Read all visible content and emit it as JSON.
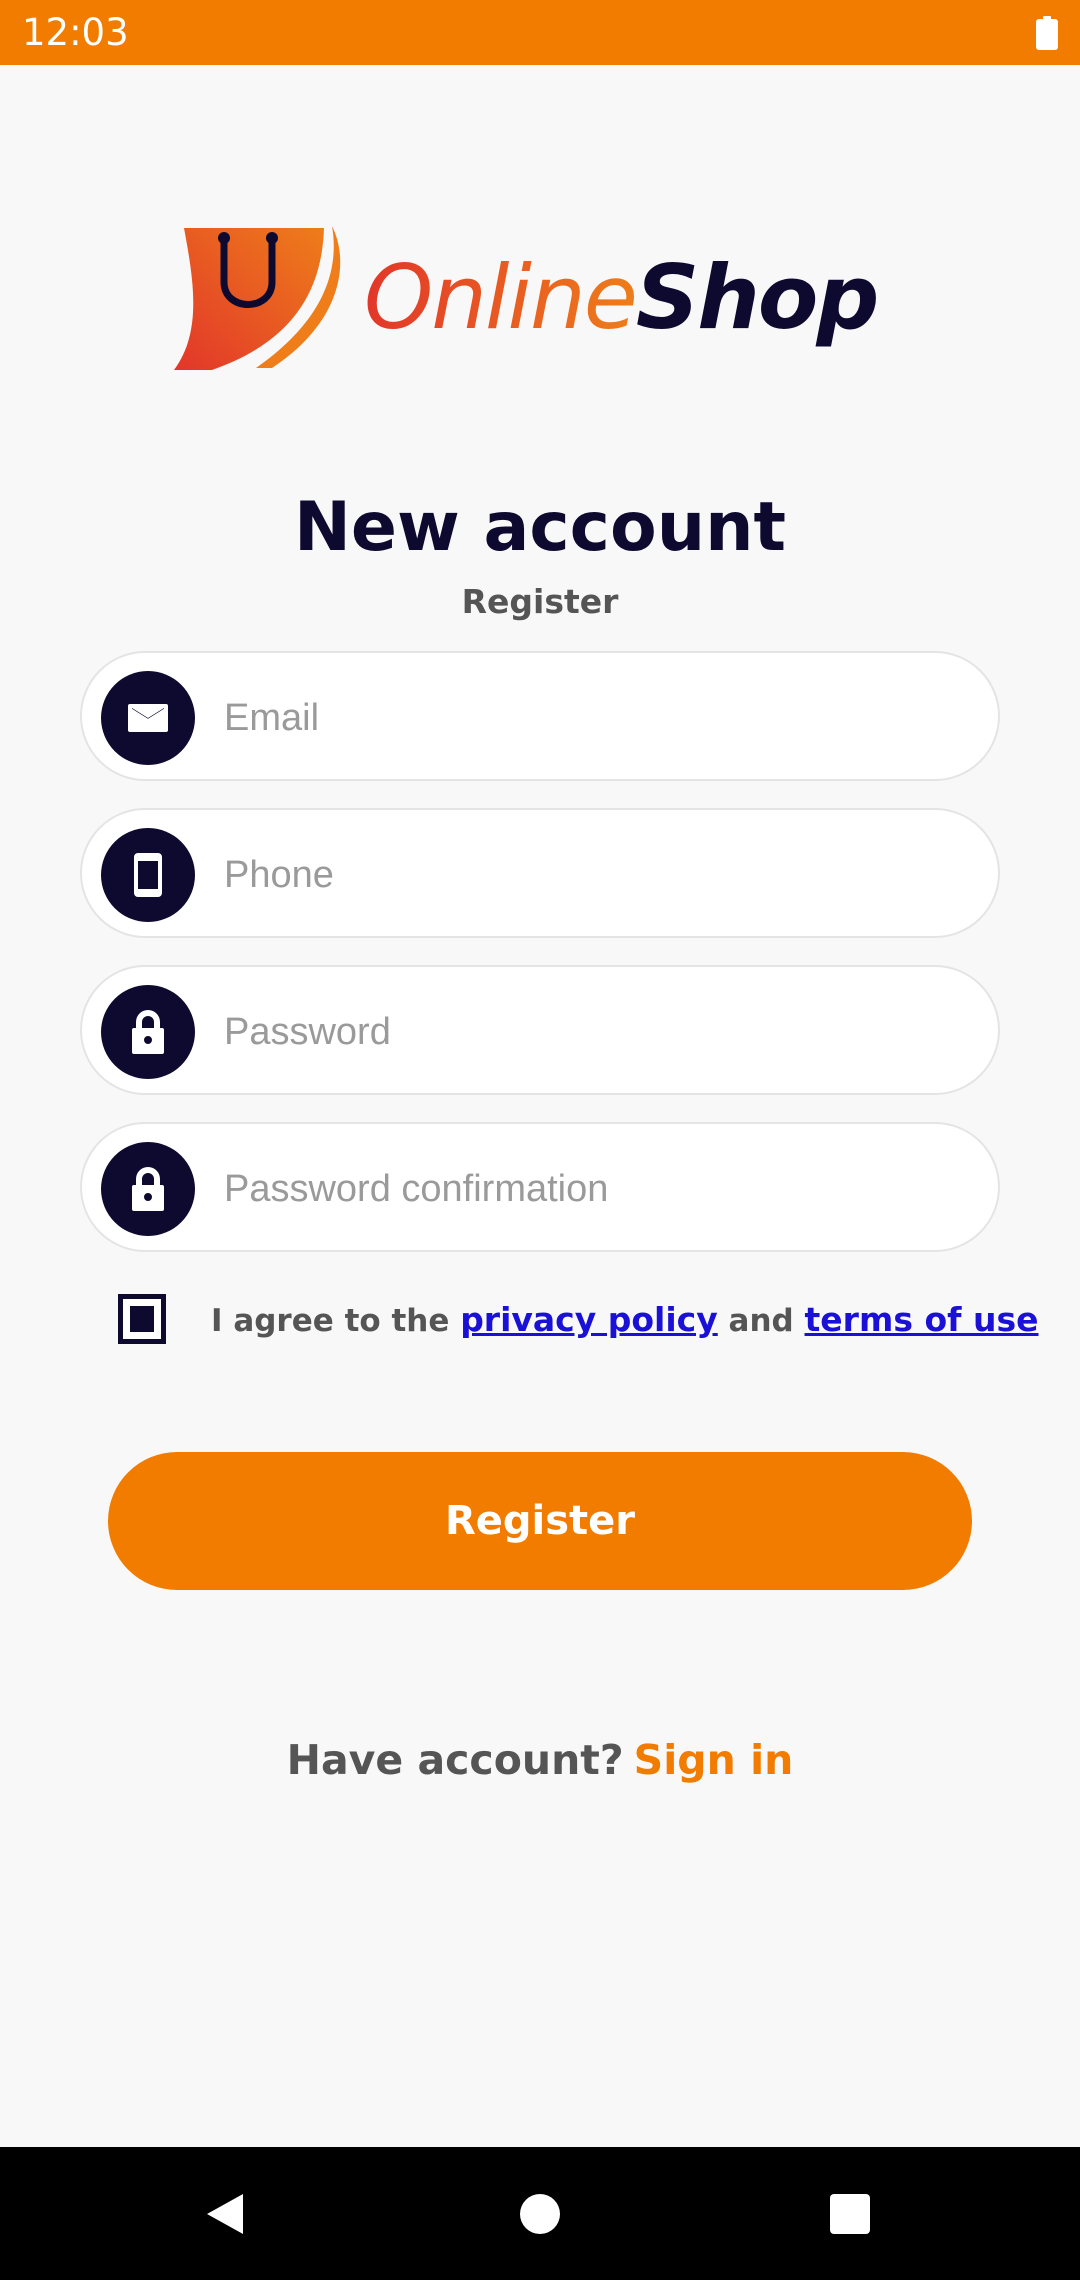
{
  "status_bar": {
    "time": "12:03"
  },
  "logo": {
    "word_online": "Online",
    "word_shop": "Shop"
  },
  "header": {
    "title": "New account",
    "subtitle": "Register"
  },
  "form": {
    "email": {
      "value": "",
      "placeholder": "Email",
      "icon": "mail-icon"
    },
    "phone": {
      "value": "",
      "placeholder": "Phone",
      "icon": "phone-icon"
    },
    "password": {
      "value": "",
      "placeholder": "Password",
      "icon": "lock-icon"
    },
    "password_confirmation": {
      "value": "",
      "placeholder": "Password confirmation",
      "icon": "lock-icon"
    }
  },
  "agreement": {
    "prefix": "I agree to the",
    "privacy_link": "privacy policy",
    "conjunction": "and",
    "terms_link": "terms of use"
  },
  "register_button": {
    "label": "Register"
  },
  "signin": {
    "question": "Have account?",
    "link": "Sign in"
  },
  "colors": {
    "accent": "#f27c00",
    "navy": "#0e0a2f",
    "link": "#1a10d6"
  }
}
